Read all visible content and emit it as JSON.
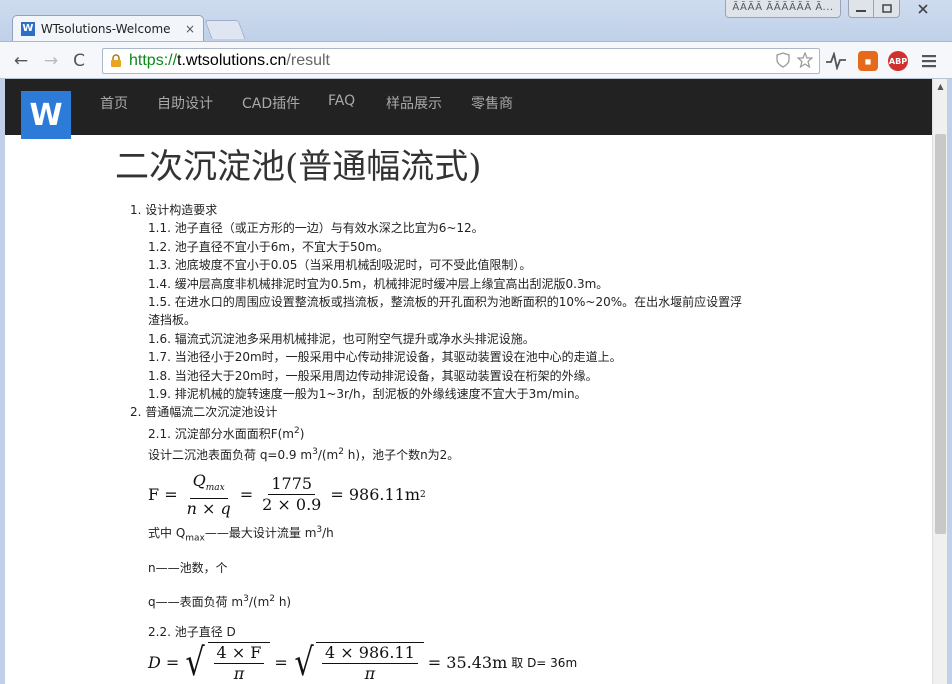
{
  "browser": {
    "tab_title": "WTsolutions-Welcome",
    "tab_favicon": "W",
    "tab_close": "×",
    "profile_badge": "ÃĀÃĀ ÃĀÃĀÃĀ Ã...",
    "url_scheme": "https://",
    "url_host": "t.wtsolutions.cn",
    "url_path": "/result",
    "ext_abp": "ABP"
  },
  "site": {
    "logo": "W",
    "nav": [
      "首页",
      "自助设计",
      "CAD插件",
      "FAQ",
      "样品展示",
      "零售商"
    ]
  },
  "content": {
    "title": "二次沉淀池(普通幅流式)",
    "s1": "1. 设计构造要求",
    "s1_items": [
      "1.1. 池子直径（或正方形的一边）与有效水深之比宜为6~12。",
      "1.2. 池子直径不宜小于6m，不宜大于50m。",
      "1.3. 池底坡度不宜小于0.05（当采用机械刮吸泥时，可不受此值限制）。",
      "1.4. 缓冲层高度非机械排泥时宜为0.5m，机械排泥时缓冲层上缘宜高出刮泥版0.3m。",
      "1.5. 在进水口的周围应设置整流板或挡流板，整流板的开孔面积为池断面积的10%~20%。在出水堰前应设置浮",
      "1.6. 辐流式沉淀池多采用机械排泥，也可附空气提升或净水头排泥设施。",
      "1.7. 当池径小于20m时，一般采用中心传动排泥设备，其驱动装置设在池中心的走道上。",
      "1.8. 当池径大于20m时，一般采用周边传动排泥设备，其驱动装置设在桁架的外缘。",
      "1.9. 排泥机械的旋转速度一般为1~3r/h，刮泥板的外缘线速度不宜大于3m/min。"
    ],
    "s1_5_cont": "渣挡板。",
    "s2": "2. 普通幅流二次沉淀池设计",
    "s2_1": "2.1. 沉淀部分水面面积F(m",
    "s2_1_close": ")",
    "s2_1_desc_a": "设计二沉池表面负荷 q=0.9 m",
    "s2_1_desc_b": "/(m",
    "s2_1_desc_c": " h)，池子个数n为2。",
    "f1": {
      "lhs": "F",
      "num": "Q",
      "num_sub": "max",
      "den": "n × q",
      "num2": "1775",
      "den2": "2 × 0.9",
      "result": "= 986.11m",
      "sup": "2"
    },
    "def_q_a": "式中 Q",
    "def_q_sub": "max",
    "def_q_b": "——最大设计流量 m",
    "def_q_c": "/h",
    "def_n": "n——池数，个",
    "def_qq_a": "q——表面负荷 m",
    "def_qq_b": "/(m",
    "def_qq_c": " h)",
    "s2_2": "2.2. 池子直径 D",
    "f2": {
      "lhs": "D",
      "in1": "4 × F",
      "den1": "π",
      "in2": "4 × 986.11",
      "den2": "π",
      "result": "= 35.43m",
      "take": "取 D= 36m"
    },
    "sup3": "3",
    "sup2": "2",
    "eq": "="
  }
}
